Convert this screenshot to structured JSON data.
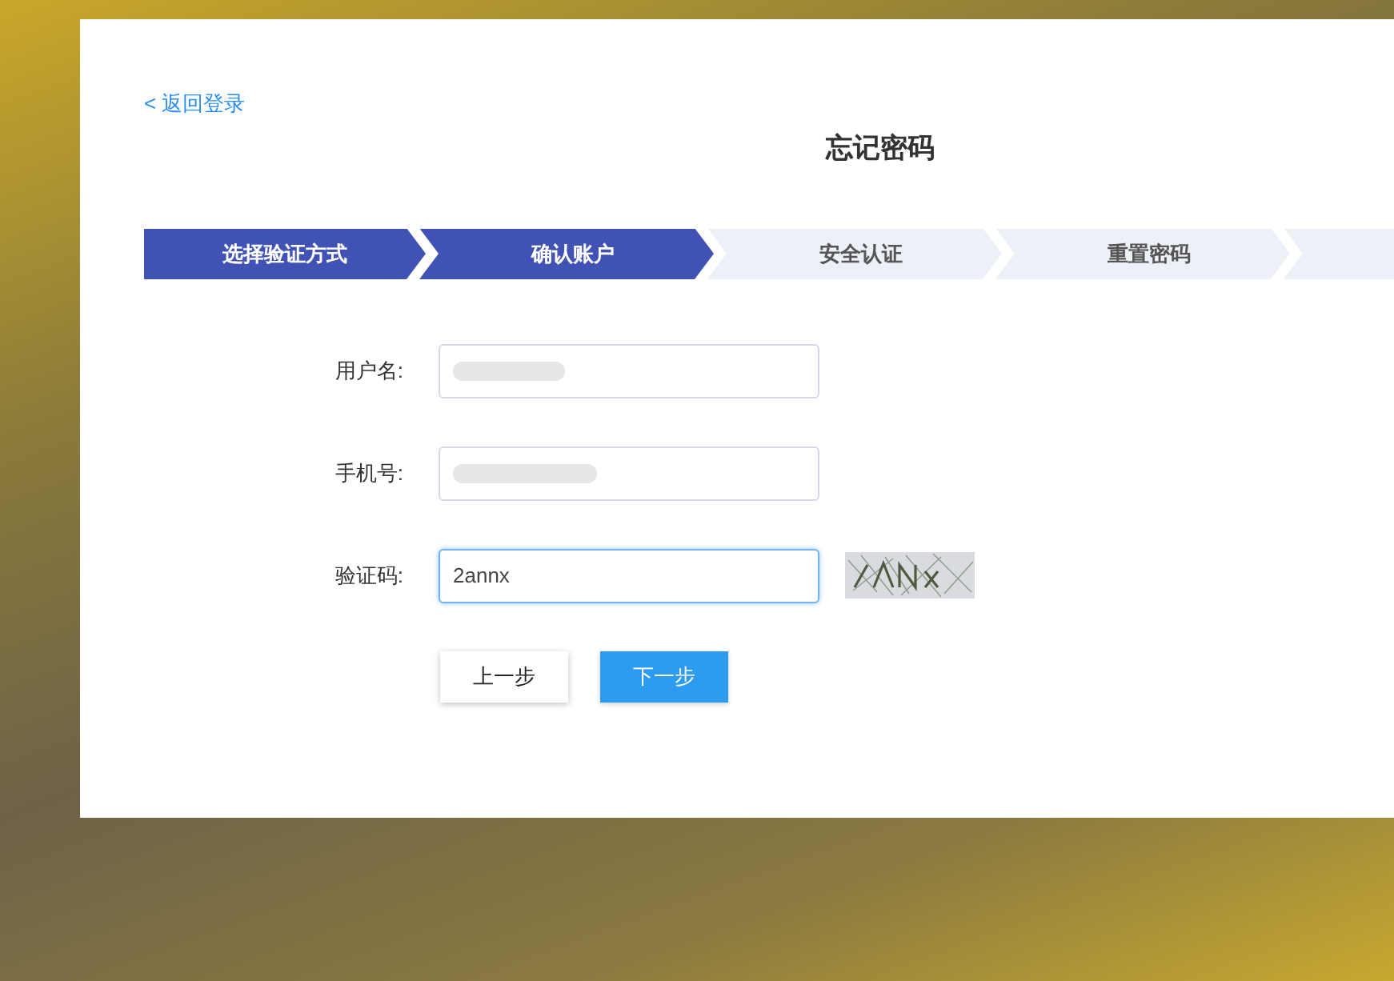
{
  "back_link": "< 返回登录",
  "title": "忘记密码",
  "steps": [
    {
      "label": "选择验证方式",
      "done": true
    },
    {
      "label": "确认账户",
      "done": true
    },
    {
      "label": "安全认证",
      "done": false
    },
    {
      "label": "重置密码",
      "done": false
    },
    {
      "done": false
    }
  ],
  "fields": [
    {
      "label": "用户名:",
      "kind": "redacted",
      "focused": false
    },
    {
      "label": "手机号:",
      "kind": "redacted",
      "focused": false
    },
    {
      "label": "验证码:",
      "kind": "captcha",
      "value": "2annx",
      "focused": true
    }
  ],
  "buttons": [
    {
      "label": "上一步",
      "primary": false
    },
    {
      "label": "下一步",
      "primary": true
    }
  ]
}
